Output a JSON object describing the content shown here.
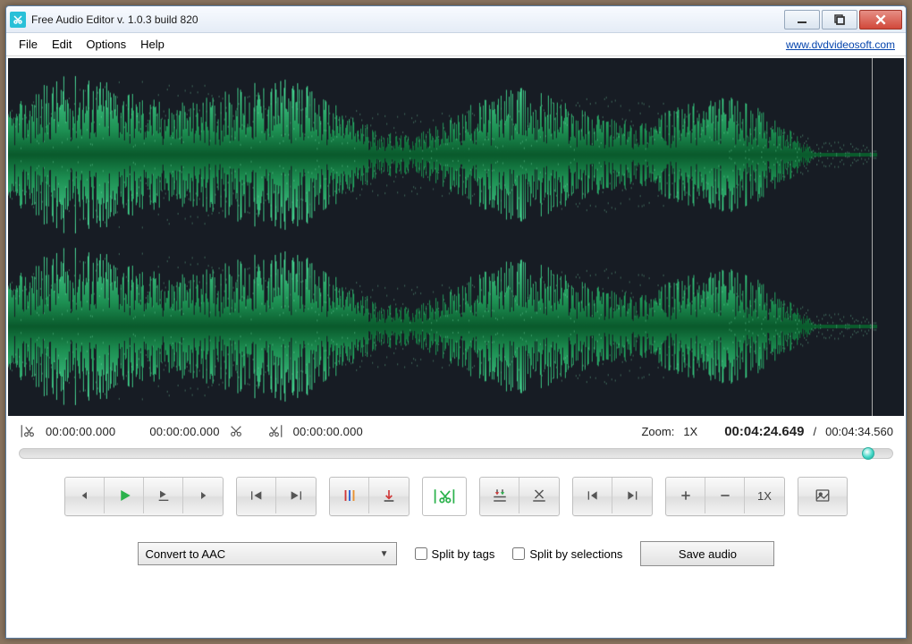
{
  "window": {
    "title": "Free Audio Editor v. 1.0.3 build 820"
  },
  "menu": {
    "file": "File",
    "edit": "Edit",
    "options": "Options",
    "help": "Help",
    "link": "www.dvdvideosoft.com"
  },
  "timecodes": {
    "sel_start": "00:00:00.000",
    "sel_end": "00:00:00.000",
    "clip": "00:00:00.000",
    "zoom_label": "Zoom:",
    "zoom_value": "1X",
    "position": "00:04:24.649",
    "sep": "/",
    "total": "00:04:34.560"
  },
  "toolbar": {
    "zoom_button": "1X"
  },
  "bottom": {
    "convert": "Convert to AAC",
    "split_tags": "Split by tags",
    "split_sel": "Split by selections",
    "save": "Save audio"
  }
}
